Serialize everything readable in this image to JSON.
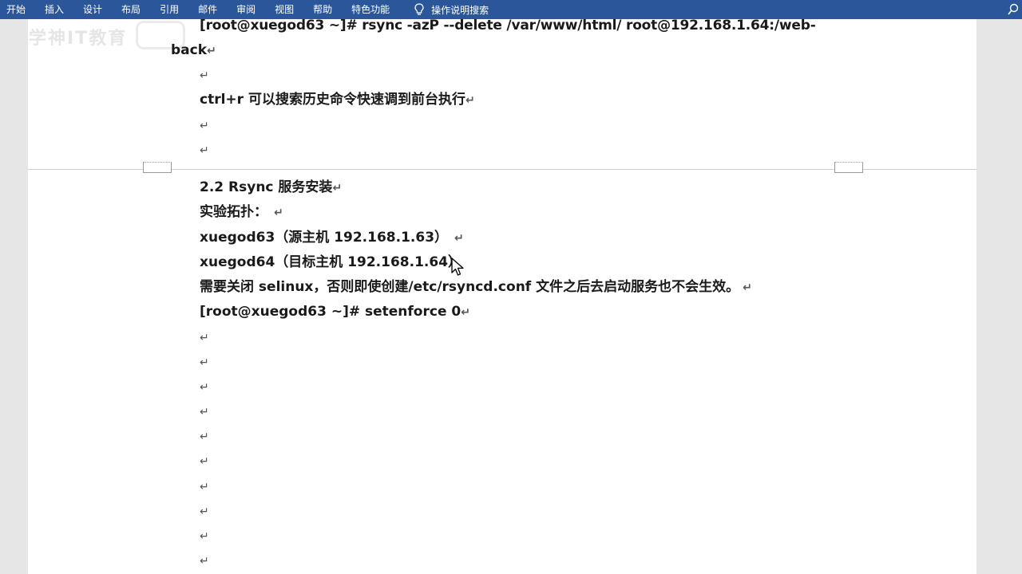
{
  "ribbon": {
    "tabs": [
      "开始",
      "插入",
      "设计",
      "布局",
      "引用",
      "邮件",
      "审阅",
      "视图",
      "帮助",
      "特色功能"
    ],
    "tell_me": "操作说明搜索"
  },
  "watermark": "学神IT教育",
  "para_mark": "↵",
  "doc": {
    "cmd_rsync_line1": "[root@xuegod63 ~]# rsync -azP --delete /var/www/html/   root@192.168.1.64:/web-",
    "cmd_rsync_line2": "back",
    "ctrl_r_tip": "ctrl+r 可以搜索历史命令快速调到前台执行",
    "heading": "2.2    Rsync 服务安装",
    "topology_label": "实验拓扑：",
    "host63": "xuegod63（源主机 192.168.1.63）",
    "host64": "xuegod64（目标主机  192.168.1.64）",
    "selinux_note": "需要关闭 selinux，否则即使创建/etc/rsyncd.conf 文件之后去启动服务也不会生效。",
    "cmd_setenforce": "[root@xuegod63 ~]# setenforce 0"
  }
}
